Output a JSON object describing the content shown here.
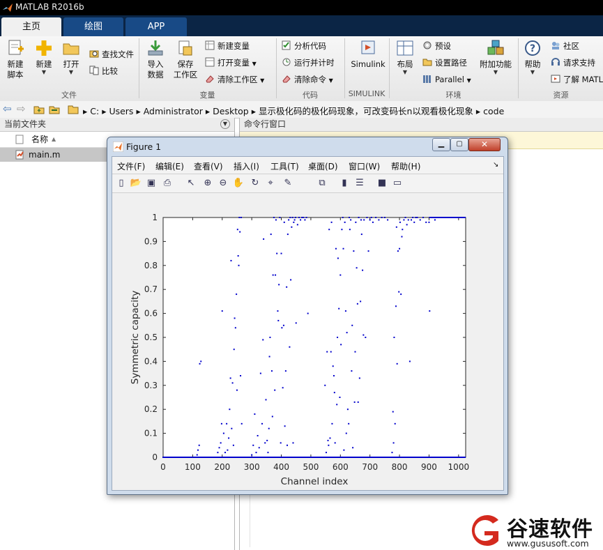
{
  "window": {
    "title": "MATLAB R2016b"
  },
  "tabs": [
    {
      "label": "主页"
    },
    {
      "label": "绘图"
    },
    {
      "label": "APP"
    }
  ],
  "ribbon": {
    "file": {
      "group_label": "文件",
      "new_script": "新建\n脚本",
      "new": "新建",
      "open": "打开",
      "find_files": "查找文件",
      "compare": "比较"
    },
    "variable": {
      "group_label": "变量",
      "import_data": "导入\n数据",
      "save_workspace": "保存\n工作区",
      "new_variable": "新建变量",
      "open_variable": "打开变量",
      "clear_workspace": "清除工作区"
    },
    "code": {
      "group_label": "代码",
      "analyze_code": "分析代码",
      "run_and_time": "运行并计时",
      "clear_commands": "清除命令"
    },
    "simulink": {
      "group_label": "SIMULINK",
      "simulink": "Simulink"
    },
    "environment": {
      "group_label": "环境",
      "layout": "布局",
      "preferences": "预设",
      "set_path": "设置路径",
      "parallel": "Parallel",
      "addons": "附加功能"
    },
    "resources": {
      "group_label": "资源",
      "help": "帮助",
      "community": "社区",
      "request_support": "请求支持",
      "learn_matlab": "了解 MATL"
    }
  },
  "address": {
    "path": [
      "C:",
      "Users",
      "Administrator",
      "Desktop",
      "显示极化码的极化码现象，可改变码长n以观看极化现象",
      "code"
    ]
  },
  "current_folder": {
    "title": "当前文件夹",
    "column_name": "名称",
    "files": [
      {
        "name": "main.m"
      }
    ]
  },
  "command_window": {
    "title": "命令行窗口"
  },
  "figure": {
    "title": "Figure 1",
    "menu": [
      "文件(F)",
      "编辑(E)",
      "查看(V)",
      "插入(I)",
      "工具(T)",
      "桌面(D)",
      "窗口(W)",
      "帮助(H)"
    ],
    "toolbar_icons": [
      "new-figure-icon",
      "open-file-icon",
      "save-icon",
      "print-icon",
      "pointer-icon",
      "zoom-in-icon",
      "zoom-out-icon",
      "pan-icon",
      "rotate-icon",
      "data-cursor-icon",
      "brush-icon",
      "link-plot-icon",
      "colorbar-icon",
      "legend-icon",
      "hide-plot-tools-icon",
      "show-plot-tools-icon"
    ]
  },
  "chart_data": {
    "type": "scatter",
    "title": "",
    "xlabel": "Channel index",
    "ylabel": "Symmetric capacity",
    "xlim": [
      0,
      1024
    ],
    "ylim": [
      0,
      1
    ],
    "xticks": [
      0,
      100,
      200,
      300,
      400,
      500,
      600,
      700,
      800,
      900,
      1000
    ],
    "yticks": [
      0,
      0.1,
      0.2,
      0.3,
      0.4,
      0.5,
      0.6,
      0.7,
      0.8,
      0.9,
      1
    ],
    "grid": false,
    "marker_color": "#0000cc",
    "series": [
      {
        "points": [
          [
            0,
            0
          ],
          [
            15,
            0
          ],
          [
            30,
            0
          ],
          [
            45,
            0
          ],
          [
            60,
            0
          ],
          [
            75,
            0
          ],
          [
            90,
            0
          ],
          [
            105,
            0
          ],
          [
            120,
            0
          ],
          [
            135,
            0
          ],
          [
            150,
            0
          ],
          [
            165,
            0
          ],
          [
            180,
            0
          ],
          [
            195,
            0
          ],
          [
            210,
            0
          ],
          [
            225,
            0
          ],
          [
            240,
            0
          ],
          [
            255,
            0
          ],
          [
            270,
            0
          ],
          [
            285,
            0
          ],
          [
            300,
            0
          ],
          [
            315,
            0
          ],
          [
            330,
            0
          ],
          [
            345,
            0
          ],
          [
            360,
            0
          ],
          [
            375,
            0
          ],
          [
            390,
            0
          ],
          [
            405,
            0
          ],
          [
            420,
            0
          ],
          [
            435,
            0
          ],
          [
            450,
            0
          ],
          [
            465,
            0
          ],
          [
            480,
            0
          ],
          [
            495,
            0
          ],
          [
            510,
            0
          ],
          [
            525,
            0
          ],
          [
            540,
            0
          ],
          [
            555,
            0
          ],
          [
            570,
            0
          ],
          [
            585,
            0
          ],
          [
            600,
            0
          ],
          [
            615,
            0
          ],
          [
            630,
            0
          ],
          [
            645,
            0
          ],
          [
            660,
            0
          ],
          [
            675,
            0
          ],
          [
            690,
            0
          ],
          [
            705,
            0
          ],
          [
            720,
            0
          ],
          [
            735,
            0
          ],
          [
            750,
            0
          ],
          [
            765,
            0
          ],
          [
            780,
            0
          ],
          [
            795,
            0
          ],
          [
            810,
            0
          ],
          [
            825,
            0
          ],
          [
            840,
            0
          ],
          [
            855,
            0
          ],
          [
            870,
            0
          ],
          [
            885,
            0
          ],
          [
            900,
            0
          ],
          [
            915,
            0
          ],
          [
            930,
            0
          ],
          [
            945,
            0
          ],
          [
            960,
            0
          ],
          [
            975,
            0
          ],
          [
            990,
            0
          ],
          [
            1005,
            0
          ],
          [
            1020,
            0
          ],
          [
            115,
            0.01
          ],
          [
            118,
            0.03
          ],
          [
            122,
            0.05
          ],
          [
            124,
            0.39
          ],
          [
            128,
            0.4
          ],
          [
            185,
            0.02
          ],
          [
            190,
            0.04
          ],
          [
            195,
            0.06
          ],
          [
            198,
            0.14
          ],
          [
            200,
            0.61
          ],
          [
            205,
            0.1
          ],
          [
            210,
            0.02
          ],
          [
            215,
            0.14
          ],
          [
            218,
            0.03
          ],
          [
            222,
            0.08
          ],
          [
            225,
            0.2
          ],
          [
            228,
            0.33
          ],
          [
            230,
            0.82
          ],
          [
            232,
            0.12
          ],
          [
            235,
            0.31
          ],
          [
            238,
            0.05
          ],
          [
            240,
            0.45
          ],
          [
            242,
            0.58
          ],
          [
            245,
            0.54
          ],
          [
            248,
            0.68
          ],
          [
            250,
            0.28
          ],
          [
            252,
            0.95
          ],
          [
            254,
            0.84
          ],
          [
            256,
            0.8
          ],
          [
            258,
            1
          ],
          [
            260,
            0.94
          ],
          [
            262,
            0.34
          ],
          [
            264,
            1
          ],
          [
            266,
            0.14
          ],
          [
            300,
            0.01
          ],
          [
            305,
            0.05
          ],
          [
            310,
            0.18
          ],
          [
            315,
            0.02
          ],
          [
            320,
            0.09
          ],
          [
            325,
            0.04
          ],
          [
            330,
            0.35
          ],
          [
            335,
            0.14
          ],
          [
            338,
            0.49
          ],
          [
            340,
            0.91
          ],
          [
            345,
            0.06
          ],
          [
            348,
            0.24
          ],
          [
            352,
            0.07
          ],
          [
            355,
            0.02
          ],
          [
            358,
            0.12
          ],
          [
            360,
            0.42
          ],
          [
            362,
            0.5
          ],
          [
            365,
            0.93
          ],
          [
            368,
            0.36
          ],
          [
            370,
            0.17
          ],
          [
            372,
            0.76
          ],
          [
            375,
            1
          ],
          [
            378,
            0.28
          ],
          [
            380,
            0.76
          ],
          [
            382,
            0.99
          ],
          [
            385,
            0.85
          ],
          [
            388,
            0.61
          ],
          [
            390,
            0.57
          ],
          [
            392,
            0.72
          ],
          [
            395,
            1
          ],
          [
            398,
            0.06
          ],
          [
            400,
            0.85
          ],
          [
            402,
            0.54
          ],
          [
            405,
            0.29
          ],
          [
            408,
            0.55
          ],
          [
            410,
            0.98
          ],
          [
            412,
            0.13
          ],
          [
            415,
            0.36
          ],
          [
            418,
            0.71
          ],
          [
            420,
            0.05
          ],
          [
            422,
            0.93
          ],
          [
            425,
            0.99
          ],
          [
            428,
            0.46
          ],
          [
            430,
            1
          ],
          [
            432,
            0.74
          ],
          [
            435,
            0.96
          ],
          [
            438,
            1
          ],
          [
            440,
            0.06
          ],
          [
            442,
            0.98
          ],
          [
            445,
            0.99
          ],
          [
            448,
            1
          ],
          [
            450,
            0.56
          ],
          [
            455,
            0.97
          ],
          [
            460,
            1
          ],
          [
            465,
            0.99
          ],
          [
            470,
            1
          ],
          [
            475,
            1
          ],
          [
            480,
            0.99
          ],
          [
            485,
            1
          ],
          [
            490,
            0.6
          ],
          [
            548,
            0.3
          ],
          [
            552,
            0.02
          ],
          [
            555,
            0.44
          ],
          [
            558,
            0.07
          ],
          [
            560,
            0.05
          ],
          [
            562,
            0.95
          ],
          [
            565,
            0.08
          ],
          [
            568,
            0.44
          ],
          [
            570,
            0.98
          ],
          [
            572,
            0.14
          ],
          [
            575,
            0.38
          ],
          [
            578,
            0.34
          ],
          [
            580,
            0.27
          ],
          [
            582,
            0.06
          ],
          [
            585,
            0.87
          ],
          [
            588,
            0.22
          ],
          [
            590,
            0.5
          ],
          [
            592,
            0.83
          ],
          [
            595,
            0.62
          ],
          [
            598,
            0.25
          ],
          [
            600,
            0.76
          ],
          [
            602,
            0.47
          ],
          [
            605,
            0.95
          ],
          [
            608,
            1
          ],
          [
            610,
            0.87
          ],
          [
            612,
            0.03
          ],
          [
            615,
            0.98
          ],
          [
            618,
            0.61
          ],
          [
            620,
            0.1
          ],
          [
            622,
            0.52
          ],
          [
            625,
            0.2
          ],
          [
            628,
            0.14
          ],
          [
            630,
            1
          ],
          [
            632,
            0.95
          ],
          [
            635,
            0.99
          ],
          [
            638,
            0.36
          ],
          [
            640,
            0.55
          ],
          [
            642,
            0.04
          ],
          [
            645,
            0.86
          ],
          [
            648,
            0.23
          ],
          [
            650,
            0.44
          ],
          [
            652,
            0.98
          ],
          [
            655,
            0.79
          ],
          [
            658,
            0.64
          ],
          [
            660,
            0.23
          ],
          [
            662,
            1
          ],
          [
            665,
            0.33
          ],
          [
            668,
            0.65
          ],
          [
            670,
            0.99
          ],
          [
            672,
            0.93
          ],
          [
            675,
            0.78
          ],
          [
            678,
            0.51
          ],
          [
            680,
            0.99
          ],
          [
            685,
            0.5
          ],
          [
            690,
            1
          ],
          [
            695,
            0.86
          ],
          [
            700,
            0.99
          ],
          [
            705,
            1
          ],
          [
            710,
            0.98
          ],
          [
            720,
            1
          ],
          [
            730,
            0.99
          ],
          [
            740,
            1
          ],
          [
            750,
            1
          ],
          [
            760,
            0.99
          ],
          [
            775,
            0.02
          ],
          [
            778,
            0.19
          ],
          [
            780,
            0.06
          ],
          [
            782,
            0.5
          ],
          [
            785,
            0.14
          ],
          [
            788,
            0.63
          ],
          [
            790,
            0.96
          ],
          [
            792,
            0.39
          ],
          [
            795,
            0.86
          ],
          [
            798,
            0.69
          ],
          [
            800,
            0.87
          ],
          [
            802,
            0.98
          ],
          [
            805,
            0.68
          ],
          [
            808,
            0.92
          ],
          [
            810,
            0.95
          ],
          [
            815,
            0.99
          ],
          [
            820,
            1
          ],
          [
            825,
            0.97
          ],
          [
            830,
            0.99
          ],
          [
            835,
            0.4
          ],
          [
            840,
            0.99
          ],
          [
            845,
            1
          ],
          [
            850,
            0.98
          ],
          [
            855,
            1
          ],
          [
            860,
            1
          ],
          [
            870,
            0.99
          ],
          [
            880,
            1
          ],
          [
            890,
            0.98
          ],
          [
            900,
            0.98
          ],
          [
            902,
            0.61
          ],
          [
            910,
            1
          ],
          [
            920,
            0.99
          ],
          [
            930,
            1
          ],
          [
            940,
            1
          ],
          [
            950,
            1
          ],
          [
            960,
            1
          ],
          [
            970,
            1
          ],
          [
            980,
            1
          ],
          [
            990,
            1
          ],
          [
            1000,
            1
          ],
          [
            1010,
            1
          ],
          [
            1020,
            1
          ]
        ]
      }
    ]
  },
  "watermark": {
    "text": "谷速软件",
    "url": "www.gususoft.com"
  }
}
